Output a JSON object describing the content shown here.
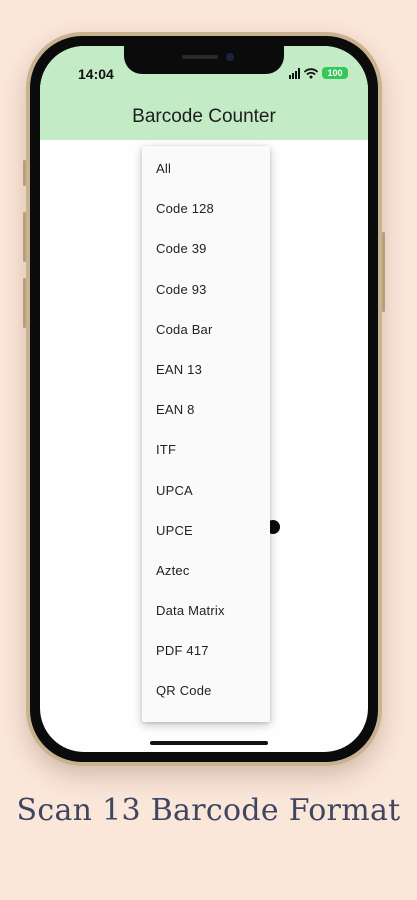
{
  "status_bar": {
    "time": "14:04",
    "battery": "100",
    "icons": [
      "cellular-signal-icon",
      "wifi-icon",
      "battery-icon"
    ],
    "battery_color": "#34c759"
  },
  "app_bar": {
    "title": "Barcode Counter",
    "background": "#c3ecc6"
  },
  "dropdown": {
    "items": [
      "All",
      "Code 128",
      "Code 39",
      "Code 93",
      "Coda Bar",
      "EAN 13",
      "EAN 8",
      "ITF",
      "UPCA",
      "UPCE",
      "Aztec",
      "Data Matrix",
      "PDF 417",
      "QR Code"
    ]
  },
  "caption": "Scan 13 Barcode Format",
  "colors": {
    "page_background": "#fbe6da",
    "caption_text": "#3f4760"
  }
}
